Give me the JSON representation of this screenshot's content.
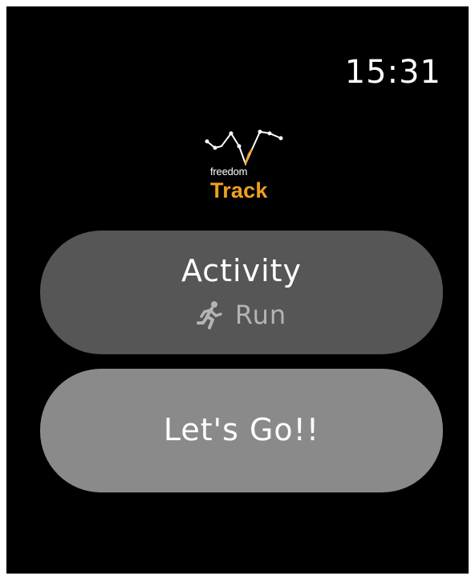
{
  "status_bar": {
    "time": "15:31"
  },
  "logo": {
    "brand": "freedom",
    "product": "Track",
    "icon": "route-line-icon",
    "accent_color": "#f0a020"
  },
  "activity_button": {
    "title": "Activity",
    "icon": "running-person-icon",
    "value": "Run"
  },
  "go_button": {
    "label": "Let's Go!!"
  },
  "colors": {
    "background": "#000000",
    "activity_button_bg": "#565656",
    "go_button_bg": "#8a8a8a",
    "secondary_text": "#b4b4b4"
  }
}
